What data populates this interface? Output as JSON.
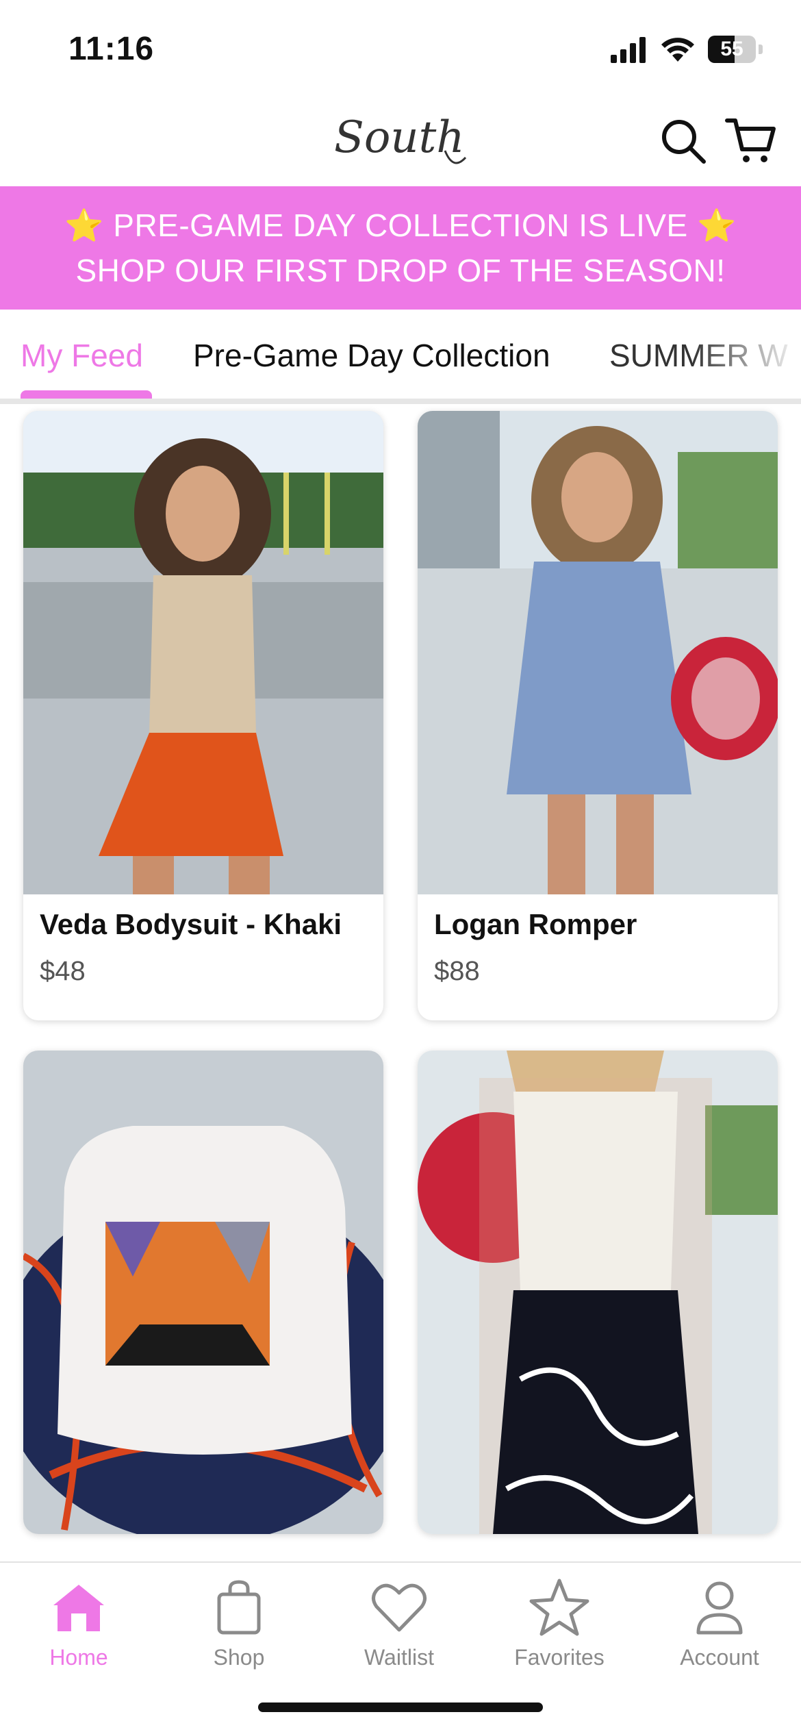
{
  "status_bar": {
    "time": "11:16",
    "battery": "55",
    "battery_level": 0.55
  },
  "header": {
    "logo_text": "South",
    "icons": [
      "search-icon",
      "cart-icon"
    ]
  },
  "promo": {
    "line1": "PRE-GAME DAY COLLECTION IS LIVE",
    "line2": "SHOP OUR FIRST DROP OF THE SEASON!",
    "star": "⭐"
  },
  "tabs": [
    {
      "label": "My Feed",
      "active": true
    },
    {
      "label": "Pre-Game Day Collection",
      "active": false
    },
    {
      "label": "SUMMER W",
      "active": false
    }
  ],
  "products": [
    {
      "name": "Veda Bodysuit - Khaki",
      "price": "$48"
    },
    {
      "name": "Logan Romper",
      "price": "$88"
    },
    {
      "name": "",
      "price": ""
    },
    {
      "name": "",
      "price": ""
    }
  ],
  "bottom_nav": [
    {
      "label": "Home",
      "icon": "home-icon",
      "active": true
    },
    {
      "label": "Shop",
      "icon": "shopping-bag-icon",
      "active": false
    },
    {
      "label": "Waitlist",
      "icon": "heart-icon",
      "active": false
    },
    {
      "label": "Favorites",
      "icon": "star-icon",
      "active": false
    },
    {
      "label": "Account",
      "icon": "user-icon",
      "active": false
    }
  ],
  "colors": {
    "accent": "#ee78e6",
    "banner_text": "#ffffff",
    "inactive_nav": "#8a8a8a"
  }
}
